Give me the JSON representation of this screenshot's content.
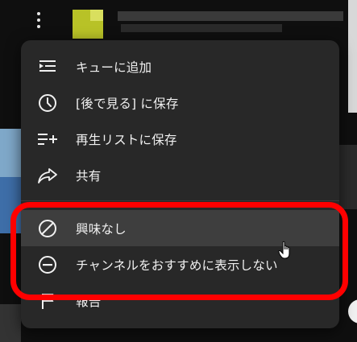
{
  "menu": {
    "items": [
      {
        "label": "キューに追加",
        "icon": "add-to-queue-icon"
      },
      {
        "label": "[後で見る] に保存",
        "icon": "clock-icon"
      },
      {
        "label": "再生リストに保存",
        "icon": "playlist-add-icon"
      },
      {
        "label": "共有",
        "icon": "share-icon"
      },
      {
        "label": "興味なし",
        "icon": "not-interested-icon"
      },
      {
        "label": "チャンネルをおすすめに表示しない",
        "icon": "dont-recommend-icon"
      },
      {
        "label": "報告",
        "icon": "flag-icon"
      }
    ]
  },
  "colors": {
    "menu_bg": "#282828",
    "hover_bg": "#3e3e3e",
    "highlight": "#ff0000",
    "text": "#f1f1f1"
  }
}
